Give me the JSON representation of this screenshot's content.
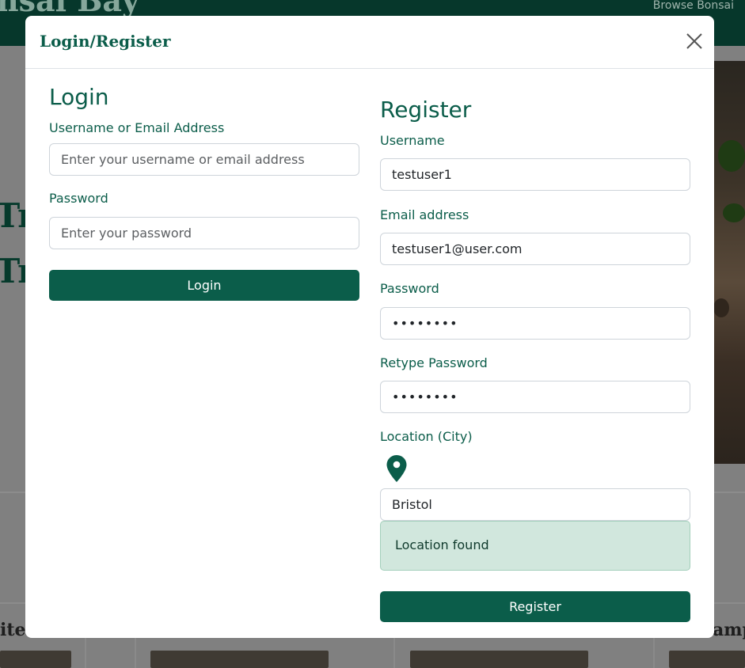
{
  "background": {
    "brand": "nsai Bay",
    "nav_link": "Browse Bonsai",
    "hero_line1": "Tr",
    "hero_line2": "Tre",
    "card_left_label": "ite",
    "card_right_label": "amp"
  },
  "modal": {
    "title": "Login/Register",
    "close_icon": "close-icon"
  },
  "login": {
    "heading": "Login",
    "username_label": "Username or Email Address",
    "username_placeholder": "Enter your username or email address",
    "password_label": "Password",
    "password_placeholder": "Enter your password",
    "submit_label": "Login"
  },
  "register": {
    "heading": "Register",
    "username_label": "Username",
    "username_value": "testuser1",
    "email_label": "Email address",
    "email_value": "testuser1@user.com",
    "password_label": "Password",
    "password_value": "••••••••",
    "retype_label": "Retype Password",
    "retype_value": "••••••••",
    "location_label": "Location (City)",
    "location_icon": "map-pin-icon",
    "location_value": "Bristol",
    "location_status": "Location found",
    "submit_label": "Register"
  },
  "colors": {
    "brand_green": "#0b5d4a",
    "nav_dark": "#06372b",
    "alert_bg": "#d1e7dd"
  }
}
